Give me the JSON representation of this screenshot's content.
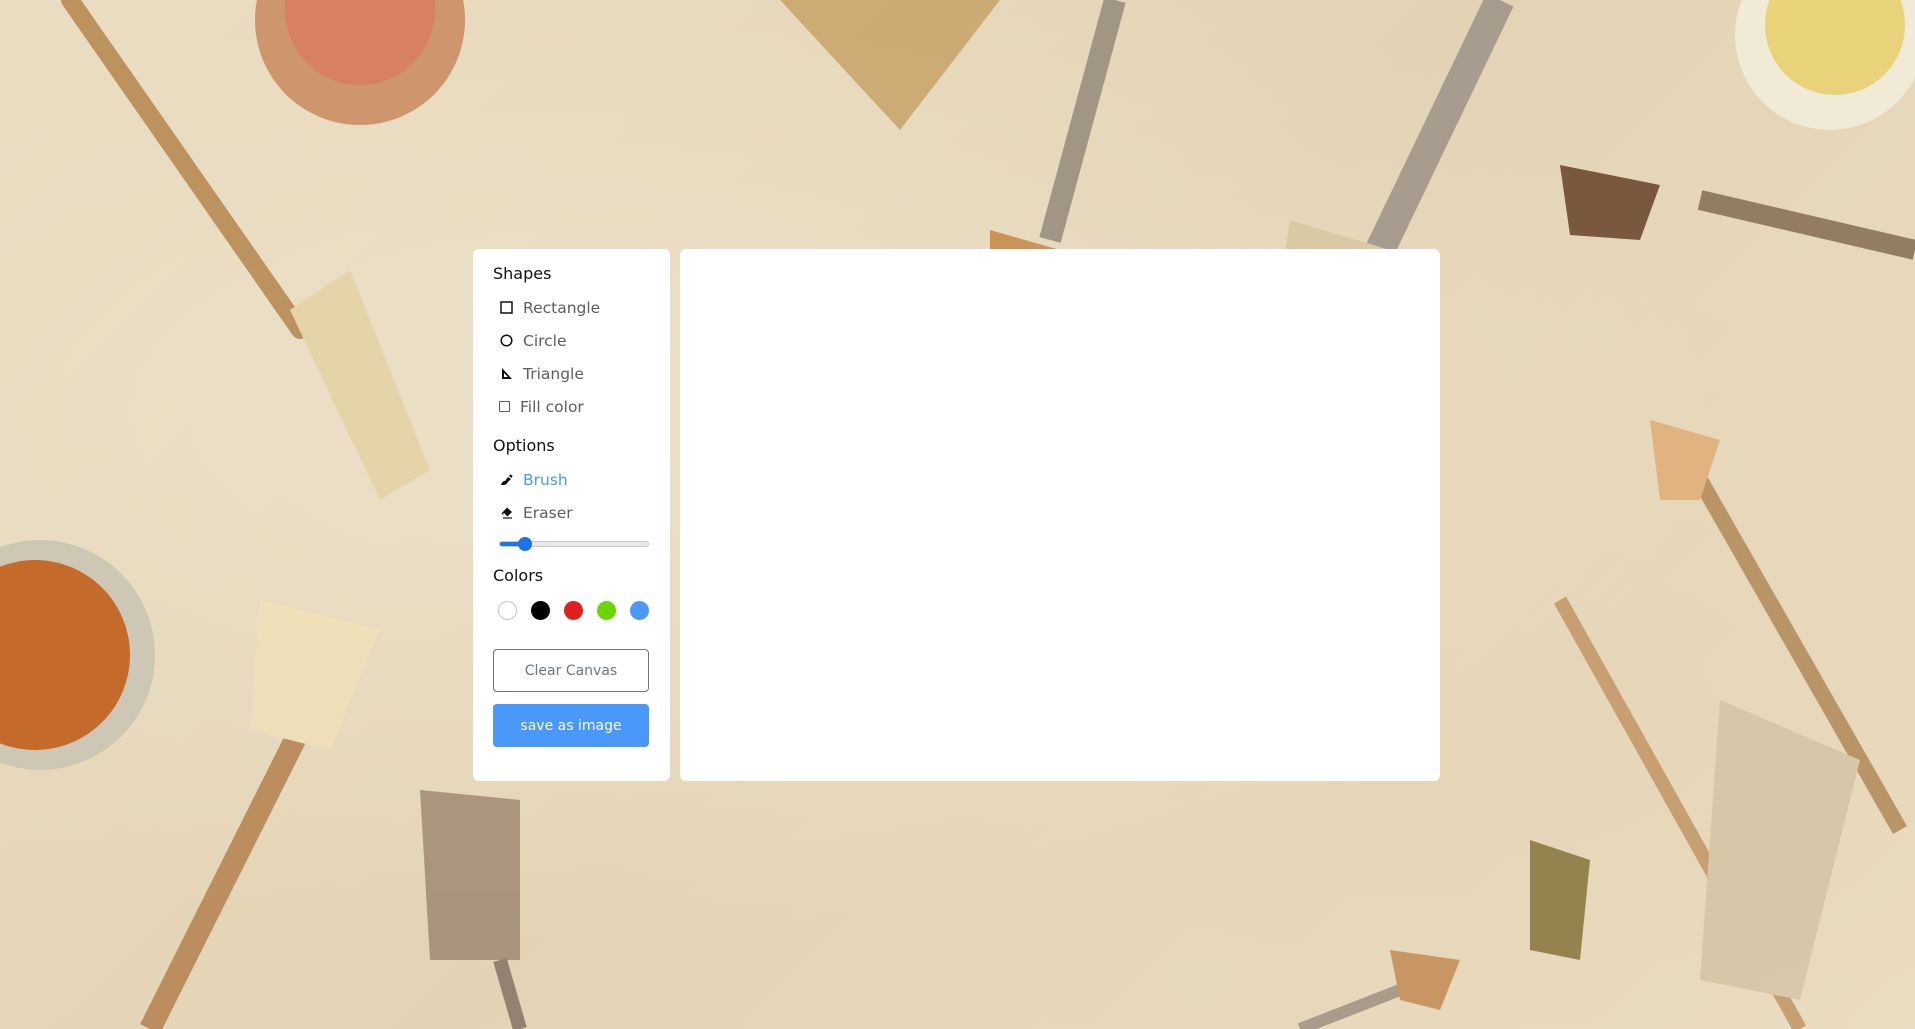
{
  "shapes": {
    "title": "Shapes",
    "items": [
      {
        "label": "Rectangle",
        "icon": "square-outline-icon"
      },
      {
        "label": "Circle",
        "icon": "circle-outline-icon"
      },
      {
        "label": "Triangle",
        "icon": "triangle-ruler-icon"
      }
    ],
    "fill_label": "Fill color",
    "fill_checked": false
  },
  "options": {
    "title": "Options",
    "items": [
      {
        "label": "Brush",
        "icon": "brush-icon",
        "active": true
      },
      {
        "label": "Eraser",
        "icon": "eraser-icon",
        "active": false
      }
    ],
    "brush_size_fraction": 0.17
  },
  "colors": {
    "title": "Colors",
    "swatches": [
      "#ffffff",
      "#000000",
      "#e02020",
      "#6dd400",
      "#4a98f7"
    ]
  },
  "buttons": {
    "clear_label": "Clear Canvas",
    "save_label": "save as image"
  },
  "theme": {
    "accent": "#4a98f7",
    "slider": "#1a73e8"
  }
}
